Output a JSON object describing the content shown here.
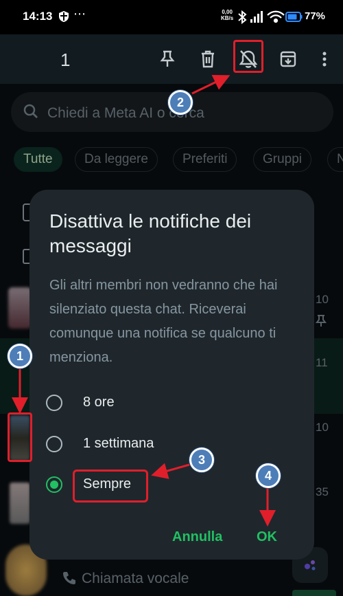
{
  "status_bar": {
    "time": "14:13",
    "overflow": "⋯",
    "speed_value": "0,00",
    "speed_unit": "KB/s",
    "battery": "77%"
  },
  "action_bar": {
    "selected_count": "1",
    "icons": [
      "pin-icon",
      "delete-icon",
      "mute-icon",
      "archive-icon",
      "more-icon"
    ]
  },
  "search": {
    "placeholder": "Chiedi a Meta AI o cerca"
  },
  "filters": [
    "Tutte",
    "Da leggere",
    "Preferiti",
    "Gruppi",
    "N"
  ],
  "chat_list": {
    "times": [
      "10",
      "11",
      "10",
      "35"
    ],
    "last_item_text": "Chiamata vocale"
  },
  "dialog": {
    "title": "Disattiva le notifiche dei messaggi",
    "body": "Gli altri membri non vedranno che hai silenziato questa chat. Riceverai comunque una notifica se qualcuno ti menziona.",
    "options": [
      {
        "label": "8 ore",
        "checked": false
      },
      {
        "label": "1 settimana",
        "checked": false
      },
      {
        "label": "Sempre",
        "checked": true
      }
    ],
    "cancel_label": "Annulla",
    "ok_label": "OK"
  },
  "annotations": [
    "1",
    "2",
    "3",
    "4"
  ],
  "colors": {
    "accent": "#21c063",
    "highlight": "#e01f2b",
    "marker": "#4d7eb8",
    "dialog_bg": "#1f272c"
  }
}
